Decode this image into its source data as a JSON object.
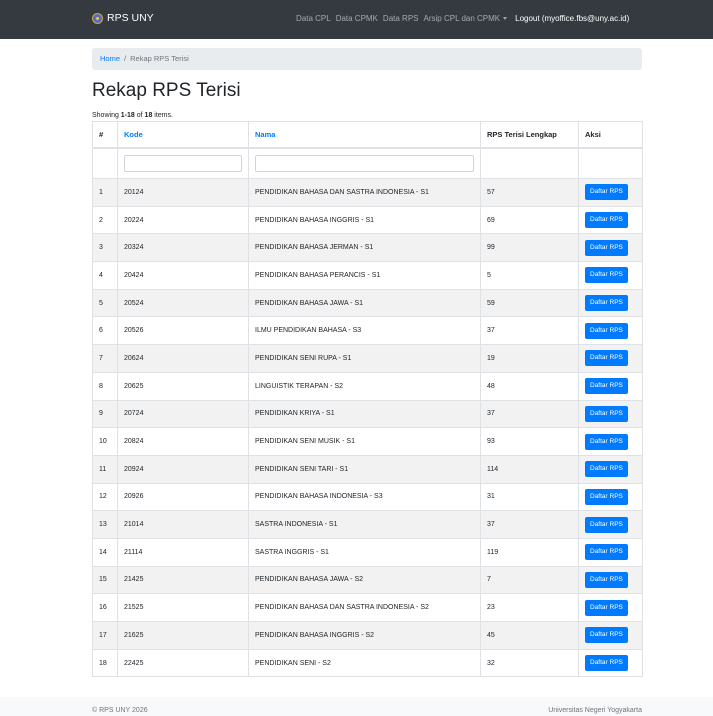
{
  "navbar": {
    "brand": "RPS UNY",
    "links": [
      "Data CPL",
      "Data CPMK",
      "Data RPS"
    ],
    "dropdown_label": "Arsip CPL dan CPMK",
    "logout_label": "Logout (myoffice.fbs@uny.ac.id)"
  },
  "breadcrumb": {
    "home": "Home",
    "separator": "/",
    "current": "Rekap RPS Terisi"
  },
  "page": {
    "title": "Rekap RPS Terisi",
    "summary_prefix": "Showing ",
    "summary_range": "1-18",
    "summary_middle": " of ",
    "summary_total": "18",
    "summary_suffix": " items."
  },
  "table": {
    "headers": [
      "#",
      "Kode",
      "Nama",
      "RPS Terisi Lengkap",
      "Aksi"
    ],
    "action_label": "Daftar RPS",
    "rows": [
      {
        "no": "1",
        "kode": "20124",
        "nama": "PENDIDIKAN BAHASA DAN SASTRA INDONESIA - S1",
        "jumlah": "57"
      },
      {
        "no": "2",
        "kode": "20224",
        "nama": "PENDIDIKAN BAHASA INGGRIS - S1",
        "jumlah": "69"
      },
      {
        "no": "3",
        "kode": "20324",
        "nama": "PENDIDIKAN BAHASA JERMAN - S1",
        "jumlah": "99"
      },
      {
        "no": "4",
        "kode": "20424",
        "nama": "PENDIDIKAN BAHASA PERANCIS - S1",
        "jumlah": "5"
      },
      {
        "no": "5",
        "kode": "20524",
        "nama": "PENDIDIKAN BAHASA JAWA - S1",
        "jumlah": "59"
      },
      {
        "no": "6",
        "kode": "20526",
        "nama": "ILMU PENDIDIKAN BAHASA - S3",
        "jumlah": "37"
      },
      {
        "no": "7",
        "kode": "20624",
        "nama": "PENDIDIKAN SENI RUPA - S1",
        "jumlah": "19"
      },
      {
        "no": "8",
        "kode": "20625",
        "nama": "LINGUISTIK TERAPAN - S2",
        "jumlah": "48"
      },
      {
        "no": "9",
        "kode": "20724",
        "nama": "PENDIDIKAN KRIYA - S1",
        "jumlah": "37"
      },
      {
        "no": "10",
        "kode": "20824",
        "nama": "PENDIDIKAN SENI MUSIK - S1",
        "jumlah": "93"
      },
      {
        "no": "11",
        "kode": "20924",
        "nama": "PENDIDIKAN SENI TARI - S1",
        "jumlah": "114"
      },
      {
        "no": "12",
        "kode": "20926",
        "nama": "PENDIDIKAN BAHASA INDONESIA - S3",
        "jumlah": "31"
      },
      {
        "no": "13",
        "kode": "21014",
        "nama": "SASTRA INDONESIA - S1",
        "jumlah": "37"
      },
      {
        "no": "14",
        "kode": "21114",
        "nama": "SASTRA INGGRIS - S1",
        "jumlah": "119"
      },
      {
        "no": "15",
        "kode": "21425",
        "nama": "PENDIDIKAN BAHASA JAWA - S2",
        "jumlah": "7"
      },
      {
        "no": "16",
        "kode": "21525",
        "nama": "PENDIDIKAN BAHASA DAN SASTRA INDONESIA - S2",
        "jumlah": "23"
      },
      {
        "no": "17",
        "kode": "21625",
        "nama": "PENDIDIKAN BAHASA INGGRIS - S2",
        "jumlah": "45"
      },
      {
        "no": "18",
        "kode": "22425",
        "nama": "PENDIDIKAN SENI - S2",
        "jumlah": "32"
      }
    ]
  },
  "footer": {
    "copyright": "© RPS UNY 2026",
    "institution": "Universitas Negeri Yogyakarta"
  },
  "colors": {
    "navbar_bg": "#343a40",
    "accent": "#007bff",
    "stripe": "#f2f2f2"
  },
  "icons": {
    "brand": "uny-logo-icon",
    "dropdown": "caret-down-icon"
  }
}
